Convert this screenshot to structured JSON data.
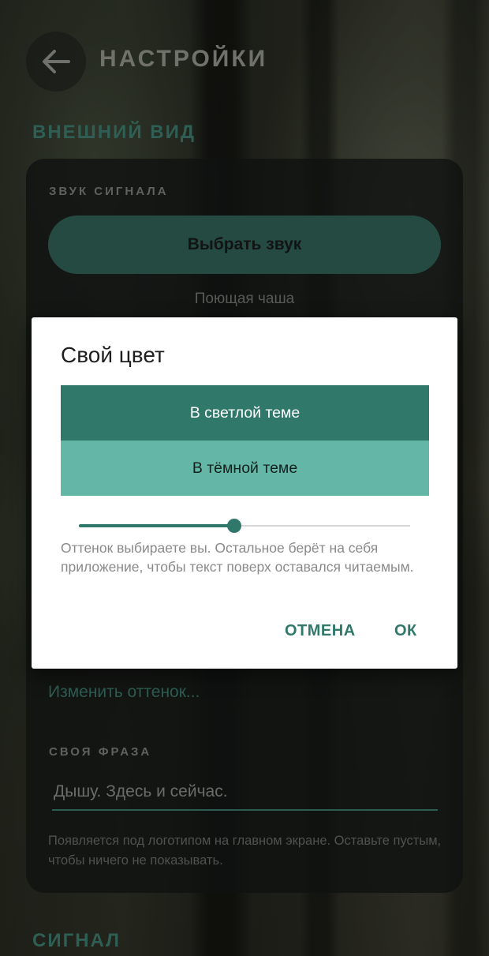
{
  "header": {
    "title": "НАСТРОЙКИ"
  },
  "sections": {
    "appearance_title": "ВНЕШНИЙ ВИД",
    "signal_title": "СИГНАЛ"
  },
  "card": {
    "sound_label": "ЗВУК СИГНАЛА",
    "pick_sound_button": "Выбрать звук",
    "current_sound": "Поющая чаша",
    "change_hue_link": "Изменить оттенок...",
    "phrase_label": "СВОЯ ФРАЗА",
    "phrase_value": "Дышу. Здесь и сейчас.",
    "phrase_hint": "Появляется под логотипом на главном экране. Оставьте пустым, чтобы ничего не показывать."
  },
  "dialog": {
    "title": "Свой цвет",
    "light_preview_label": "В светлой теме",
    "dark_preview_label": "В тёмной теме",
    "light_preview_color": "#2f786a",
    "dark_preview_color": "#64b6a6",
    "slider_value_fraction": 0.47,
    "hint": "Оттенок выбираете вы. Остальное берёт на себя приложение, чтобы текст поверх оставался читаемым.",
    "cancel_button": "ОТМЕНА",
    "ok_button": "ОК"
  },
  "colors": {
    "accent": "#2f786a",
    "accent_dim": "#2f5e55"
  },
  "icons": {
    "back": "arrow-left-icon"
  }
}
